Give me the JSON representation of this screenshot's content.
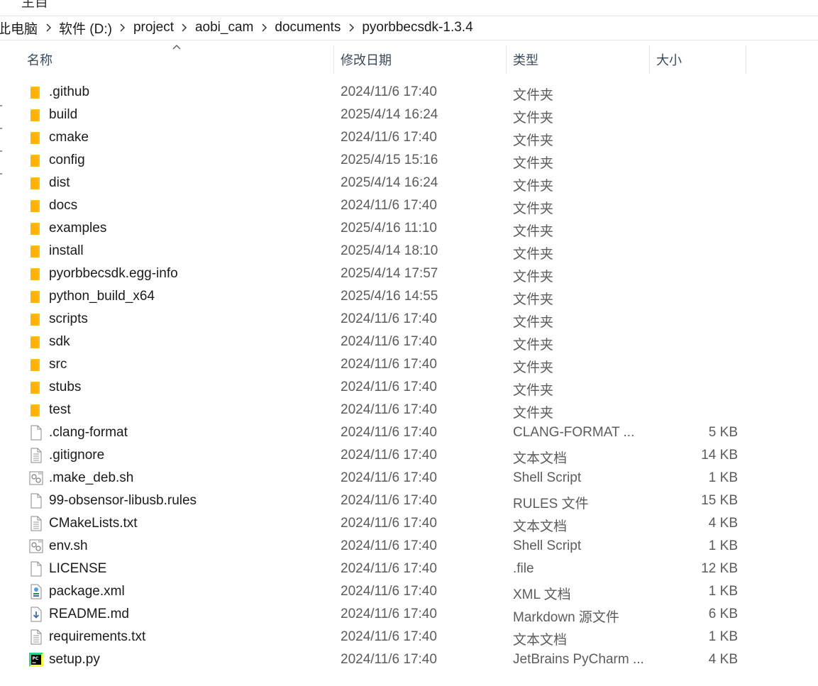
{
  "top_partial_text": "主目",
  "breadcrumb": [
    {
      "label": "此电脑"
    },
    {
      "label": "软件 (D:)"
    },
    {
      "label": "project"
    },
    {
      "label": "aobi_cam"
    },
    {
      "label": "documents"
    },
    {
      "label": "pyorbbecsdk-1.3.4"
    }
  ],
  "columns": {
    "name": "名称",
    "date": "修改日期",
    "type": "类型",
    "size": "大小"
  },
  "files": [
    {
      "name": ".github",
      "date": "2024/11/6 17:40",
      "type": "文件夹",
      "size": "",
      "icon": "folder-icon"
    },
    {
      "name": "build",
      "date": "2025/4/14 16:24",
      "type": "文件夹",
      "size": "",
      "icon": "folder-icon"
    },
    {
      "name": "cmake",
      "date": "2024/11/6 17:40",
      "type": "文件夹",
      "size": "",
      "icon": "folder-icon"
    },
    {
      "name": "config",
      "date": "2025/4/15 15:16",
      "type": "文件夹",
      "size": "",
      "icon": "folder-icon"
    },
    {
      "name": "dist",
      "date": "2025/4/14 16:24",
      "type": "文件夹",
      "size": "",
      "icon": "folder-icon"
    },
    {
      "name": "docs",
      "date": "2024/11/6 17:40",
      "type": "文件夹",
      "size": "",
      "icon": "folder-icon"
    },
    {
      "name": "examples",
      "date": "2025/4/16 11:10",
      "type": "文件夹",
      "size": "",
      "icon": "folder-icon"
    },
    {
      "name": "install",
      "date": "2025/4/14 18:10",
      "type": "文件夹",
      "size": "",
      "icon": "folder-icon"
    },
    {
      "name": "pyorbbecsdk.egg-info",
      "date": "2025/4/14 17:57",
      "type": "文件夹",
      "size": "",
      "icon": "folder-icon"
    },
    {
      "name": "python_build_x64",
      "date": "2025/4/16 14:55",
      "type": "文件夹",
      "size": "",
      "icon": "folder-icon"
    },
    {
      "name": "scripts",
      "date": "2024/11/6 17:40",
      "type": "文件夹",
      "size": "",
      "icon": "folder-icon"
    },
    {
      "name": "sdk",
      "date": "2024/11/6 17:40",
      "type": "文件夹",
      "size": "",
      "icon": "folder-icon"
    },
    {
      "name": "src",
      "date": "2024/11/6 17:40",
      "type": "文件夹",
      "size": "",
      "icon": "folder-icon"
    },
    {
      "name": "stubs",
      "date": "2024/11/6 17:40",
      "type": "文件夹",
      "size": "",
      "icon": "folder-icon"
    },
    {
      "name": "test",
      "date": "2024/11/6 17:40",
      "type": "文件夹",
      "size": "",
      "icon": "folder-icon"
    },
    {
      "name": ".clang-format",
      "date": "2024/11/6 17:40",
      "type": "CLANG-FORMAT ...",
      "size": "5 KB",
      "icon": "blank-file-icon"
    },
    {
      "name": ".gitignore",
      "date": "2024/11/6 17:40",
      "type": "文本文档",
      "size": "14 KB",
      "icon": "text-file-icon"
    },
    {
      "name": ".make_deb.sh",
      "date": "2024/11/6 17:40",
      "type": "Shell Script",
      "size": "1 KB",
      "icon": "script-file-icon"
    },
    {
      "name": "99-obsensor-libusb.rules",
      "date": "2024/11/6 17:40",
      "type": "RULES 文件",
      "size": "15 KB",
      "icon": "blank-file-icon"
    },
    {
      "name": "CMakeLists.txt",
      "date": "2024/11/6 17:40",
      "type": "文本文档",
      "size": "4 KB",
      "icon": "text-file-icon"
    },
    {
      "name": "env.sh",
      "date": "2024/11/6 17:40",
      "type": "Shell Script",
      "size": "1 KB",
      "icon": "script-file-icon"
    },
    {
      "name": "LICENSE",
      "date": "2024/11/6 17:40",
      "type": ".file",
      "size": "12 KB",
      "icon": "blank-file-icon"
    },
    {
      "name": "package.xml",
      "date": "2024/11/6 17:40",
      "type": "XML 文档",
      "size": "1 KB",
      "icon": "xml-file-icon"
    },
    {
      "name": "README.md",
      "date": "2024/11/6 17:40",
      "type": "Markdown 源文件",
      "size": "6 KB",
      "icon": "markdown-file-icon"
    },
    {
      "name": "requirements.txt",
      "date": "2024/11/6 17:40",
      "type": "文本文档",
      "size": "1 KB",
      "icon": "text-file-icon"
    },
    {
      "name": "setup.py",
      "date": "2024/11/6 17:40",
      "type": "JetBrains PyCharm ...",
      "size": "4 KB",
      "icon": "pycharm-file-icon"
    }
  ]
}
